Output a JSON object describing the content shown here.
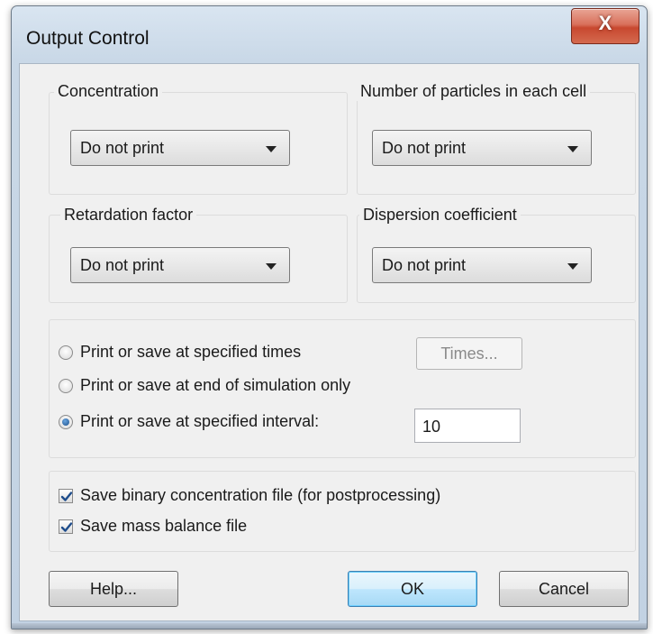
{
  "window": {
    "title": "Output Control",
    "close_glyph": "X",
    "close_icon": "close-icon"
  },
  "groups": {
    "concentration": {
      "label": "Concentration",
      "value": "Do not print"
    },
    "particles": {
      "label": "Number of particles in each cell",
      "value": "Do not print"
    },
    "retardation": {
      "label": "Retardation factor",
      "value": "Do not print"
    },
    "dispersion": {
      "label": "Dispersion coefficient",
      "value": "Do not print"
    }
  },
  "timing": {
    "options": [
      {
        "label": "Print or save at specified times",
        "selected": false
      },
      {
        "label": "Print or save at end of simulation only",
        "selected": false
      },
      {
        "label": "Print or save at specified interval:",
        "selected": true
      }
    ],
    "times_button": "Times...",
    "interval_value": "10"
  },
  "files": {
    "options": [
      {
        "label": "Save binary concentration file (for postprocessing)",
        "checked": true
      },
      {
        "label": "Save mass balance file",
        "checked": true
      }
    ]
  },
  "buttons": {
    "help": "Help...",
    "ok": "OK",
    "cancel": "Cancel"
  },
  "colors": {
    "titlebar": "#c9d8e7",
    "close_button": "#c8482f",
    "dialog_face": "#f0f0f0",
    "default_button": "#bee6fd"
  }
}
